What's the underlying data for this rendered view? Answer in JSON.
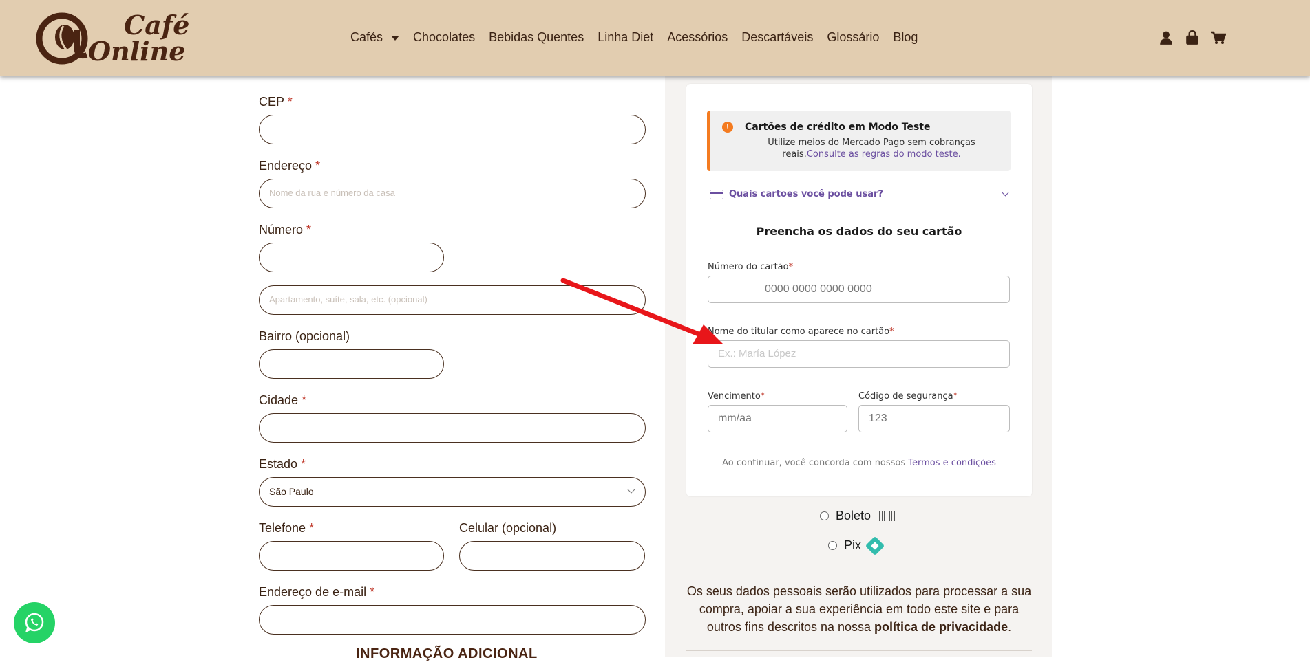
{
  "header": {
    "logo_text_line1": "Café",
    "logo_text_line2": "Online",
    "nav": [
      "Cafés",
      "Chocolates",
      "Bebidas Quentes",
      "Linha Diet",
      "Acessórios",
      "Descartáveis",
      "Glossário",
      "Blog"
    ],
    "icons": [
      "user-icon",
      "shopping-bag-icon",
      "cart-icon"
    ]
  },
  "billing_form": {
    "cep_label": "CEP",
    "address_label": "Endereço",
    "address_placeholder": "Nome da rua e número da casa",
    "number_label": "Número",
    "complement_placeholder": "Apartamento, suíte, sala, etc. (opcional)",
    "district_label": "Bairro (opcional)",
    "city_label": "Cidade",
    "state_label": "Estado",
    "state_value": "São Paulo",
    "phone_label": "Telefone",
    "mobile_label": "Celular (opcional)",
    "email_label": "Endereço de e-mail",
    "required_mark": "*",
    "additional_info_heading": "INFORMAÇÃO ADICIONAL"
  },
  "payment": {
    "alert_title": "Cartões de crédito em Modo Teste",
    "alert_body": "Utilize meios do Mercado Pago sem cobranças reais.",
    "alert_link": "Consulte as regras do modo teste.",
    "cards_question": "Quais cartões você pode usar?",
    "fill_title": "Preencha os dados do seu cartão",
    "card_number_label": "Número do cartão",
    "card_number_placeholder": "0000 0000 0000 0000",
    "holder_label": "Nome do titular como aparece no cartão",
    "holder_placeholder": "Ex.: María López",
    "expiry_label": "Vencimento",
    "expiry_placeholder": "mm/aa",
    "cvv_label": "Código de segurança",
    "cvv_placeholder": "123",
    "terms_text": "Ao continuar, você concorda com nossos ",
    "terms_link": "Termos e condições",
    "boleto_label": "Boleto",
    "pix_label": "Pix"
  },
  "privacy": {
    "text": "Os seus dados pessoais serão utilizados para processar a sua compra, apoiar a sua experiência em todo este site e para outros fins descritos na nossa ",
    "link": "política de privacidade",
    "end": "."
  },
  "colors": {
    "header_bg": "#e2cdb0",
    "brand_brown": "#4a2412",
    "mp_purple": "#6b4fa0",
    "alert_orange": "#f47b20",
    "arrow_red": "#e8161a",
    "whatsapp_green": "#25d366"
  }
}
